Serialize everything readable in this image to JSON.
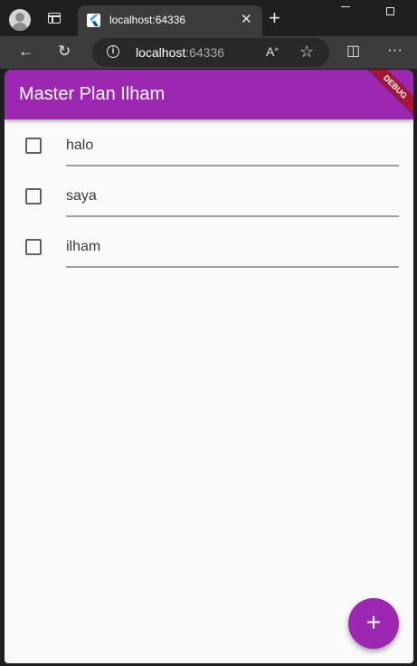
{
  "browser": {
    "tab_title": "localhost:64336",
    "url_host": "localhost",
    "url_port": ":64336",
    "read_aloud_label": "A"
  },
  "app": {
    "title": "Master Plan Ilham",
    "debug_banner": "DEBUG",
    "accent_color": "#9c27b0"
  },
  "tasks": [
    {
      "text": "halo",
      "checked": false
    },
    {
      "text": "saya",
      "checked": false
    },
    {
      "text": "ilham",
      "checked": false
    }
  ],
  "fab": {
    "icon": "add-icon",
    "label": "+"
  }
}
